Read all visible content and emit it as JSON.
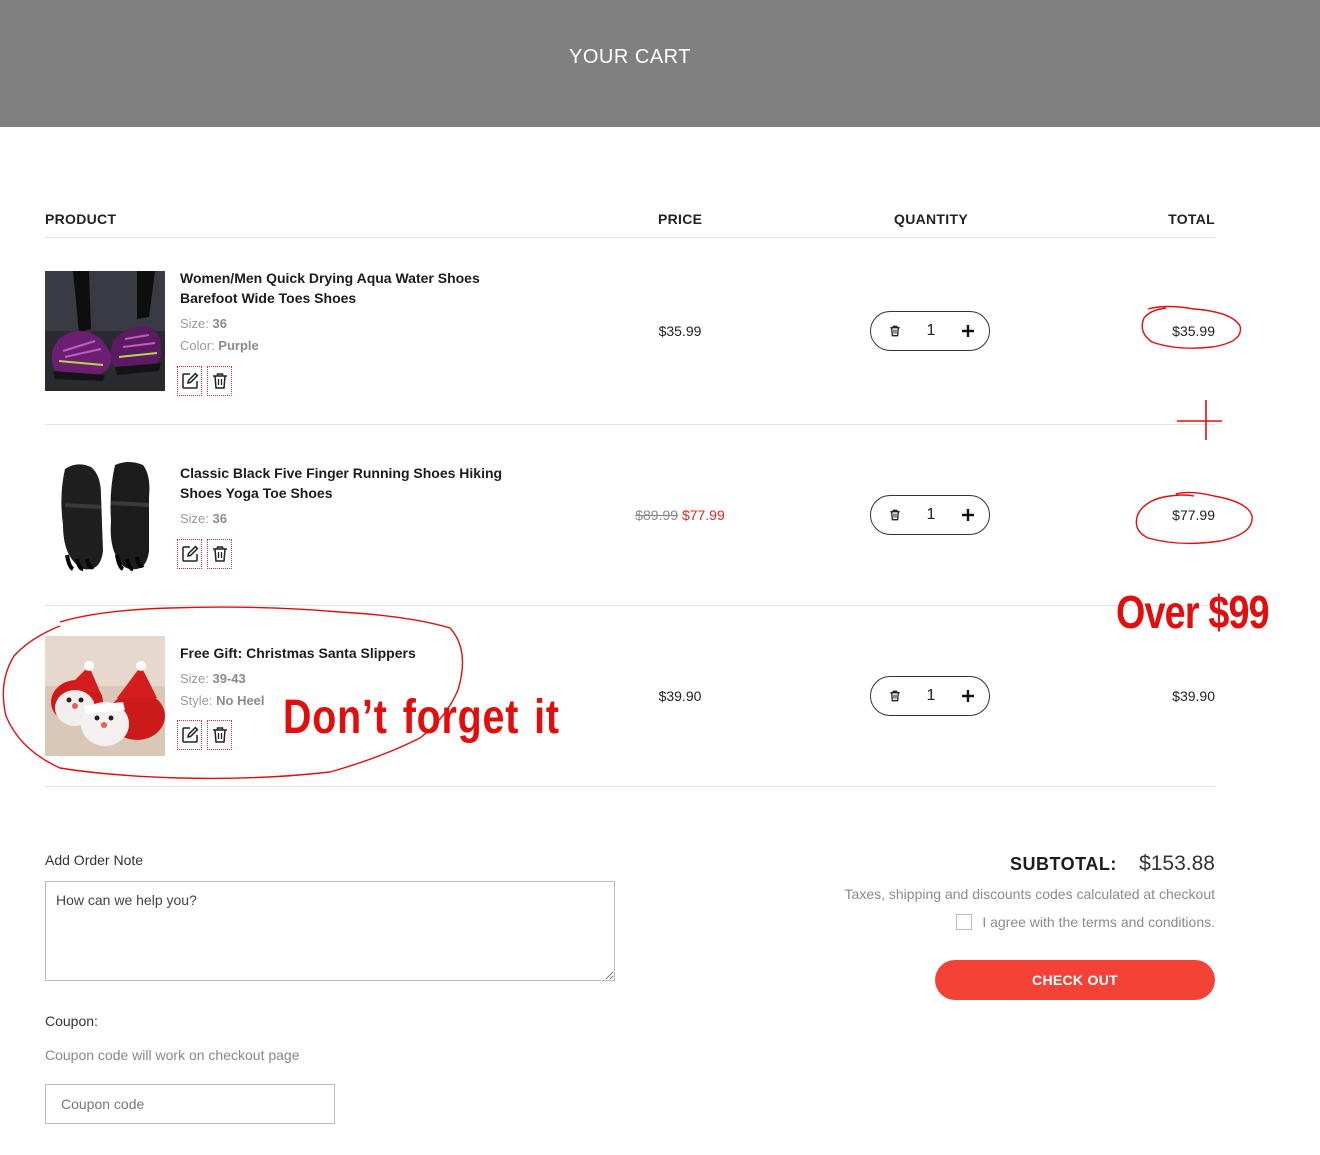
{
  "header": {
    "title": "YOUR CART"
  },
  "table_headers": {
    "product": "PRODUCT",
    "price": "PRICE",
    "quantity": "QUANTITY",
    "total": "TOTAL"
  },
  "items": [
    {
      "name": "Women/Men Quick Drying Aqua Water Shoes Barefoot Wide Toes Shoes",
      "attrs": [
        {
          "label": "Size: ",
          "value": "36"
        },
        {
          "label": "Color: ",
          "value": "Purple"
        }
      ],
      "price": "$35.99",
      "quantity": "1",
      "total": "$35.99",
      "image": "purple-aqua-water-shoes"
    },
    {
      "name": "Classic Black Five Finger Running Shoes Hiking Shoes Yoga Toe Shoes",
      "attrs": [
        {
          "label": "Size: ",
          "value": "36"
        }
      ],
      "price_original": "$89.99",
      "price": "$77.99",
      "quantity": "1",
      "total": "$77.99",
      "image": "black-five-finger-shoes"
    },
    {
      "name": "Free Gift: Christmas Santa Slippers",
      "attrs": [
        {
          "label": "Size: ",
          "value": "39-43"
        },
        {
          "label": "Style: ",
          "value": "No Heel"
        }
      ],
      "price": "$39.90",
      "quantity": "1",
      "total": "$39.90",
      "image": "santa-slippers"
    }
  ],
  "annotations": {
    "over": "Over $99",
    "dont_forget": "Don’t  forget  it"
  },
  "order_note": {
    "label": "Add Order Note",
    "placeholder": "How can we help you?"
  },
  "coupon": {
    "label": "Coupon:",
    "hint": "Coupon code will work on checkout page",
    "placeholder": "Coupon code"
  },
  "summary": {
    "subtotal_label": "SUBTOTAL:",
    "subtotal_value": "$153.88",
    "tax_note": "Taxes, shipping and discounts codes calculated at checkout",
    "agree_text": "I agree with the terms and conditions.",
    "checkout_label": "CHECK OUT"
  },
  "colors": {
    "header_bg": "#808080",
    "accent": "#f44336",
    "sale": "#e0262a",
    "annotation": "#e20e0e"
  },
  "icons": [
    "edit-icon",
    "trash-icon",
    "plus-icon"
  ]
}
